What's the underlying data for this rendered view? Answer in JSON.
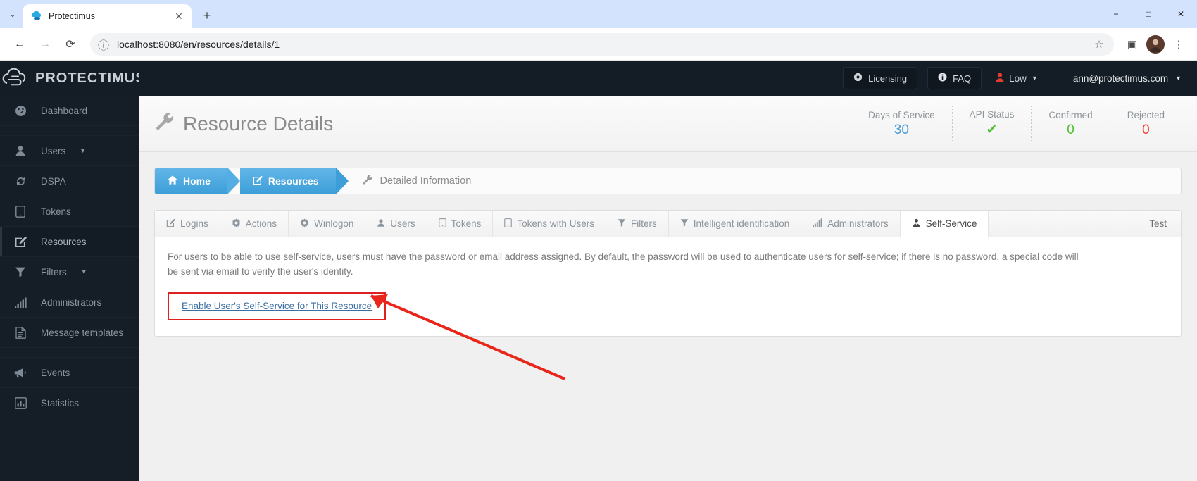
{
  "browser": {
    "tab_title": "Protectimus",
    "tab_close_glyph": "✕",
    "new_tab_glyph": "+",
    "tab_list_glyph": "⌄",
    "back_glyph": "←",
    "forward_glyph": "→",
    "reload_glyph": "⟳",
    "info_glyph": "ⓘ",
    "url": "localhost:8080/en/resources/details/1",
    "star_glyph": "☆",
    "sidepanel_glyph": "▣",
    "avatar_initial": "",
    "menu_glyph": "⋮",
    "minimize_glyph": "−",
    "maximize_glyph": "□",
    "close_glyph": "✕"
  },
  "brand": {
    "name": "PROTECTIMUS",
    "logo_icon": "cloud-lock-icon"
  },
  "sidebar": {
    "items": [
      {
        "label": "Dashboard",
        "icon": "dashboard-gauge-icon",
        "caret": false,
        "active": false
      },
      {
        "label": "Users",
        "icon": "user-icon",
        "caret": true,
        "active": false
      },
      {
        "label": "DSPA",
        "icon": "sync-icon",
        "caret": false,
        "active": false
      },
      {
        "label": "Tokens",
        "icon": "tablet-icon",
        "caret": false,
        "active": false
      },
      {
        "label": "Resources",
        "icon": "edit-square-icon",
        "caret": false,
        "active": true
      },
      {
        "label": "Filters",
        "icon": "funnel-icon",
        "caret": true,
        "active": false
      },
      {
        "label": "Administrators",
        "icon": "bar-chart-icon",
        "caret": false,
        "active": false
      },
      {
        "label": "Message templates",
        "icon": "document-icon",
        "caret": false,
        "active": false
      },
      {
        "label": "Events",
        "icon": "megaphone-icon",
        "caret": false,
        "active": false
      },
      {
        "label": "Statistics",
        "icon": "statistics-chart-icon",
        "caret": false,
        "active": false
      }
    ],
    "caret_glyph": "▼"
  },
  "topbar": {
    "licensing_label": "Licensing",
    "licensing_icon": "gear-badge-icon",
    "faq_label": "FAQ",
    "faq_icon": "info-circle-icon",
    "risk_label": "Low",
    "risk_icon": "user-risk-icon",
    "risk_color": "#e23c2f",
    "user_email": "ann@protectimus.com",
    "caret_glyph": "▼"
  },
  "header": {
    "title": "Resource Details",
    "title_icon": "wrench-icon",
    "stats": [
      {
        "label": "Days of Service",
        "value": "30",
        "color_class": "v-blue"
      },
      {
        "label": "API Status",
        "value": "✔",
        "color_class": "v-green"
      },
      {
        "label": "Confirmed",
        "value": "0",
        "color_class": "v-green"
      },
      {
        "label": "Rejected",
        "value": "0",
        "color_class": "v-red"
      }
    ]
  },
  "breadcrumb": {
    "home_label": "Home",
    "home_icon": "home-icon",
    "resources_label": "Resources",
    "resources_icon": "edit-square-icon",
    "current_label": "Detailed Information",
    "current_icon": "wrench-icon"
  },
  "tabs": {
    "items": [
      {
        "label": "Logins",
        "icon": "edit-square-icon",
        "active": false
      },
      {
        "label": "Actions",
        "icon": "gear-icon",
        "active": false
      },
      {
        "label": "Winlogon",
        "icon": "gear-icon",
        "active": false
      },
      {
        "label": "Users",
        "icon": "user-icon",
        "active": false
      },
      {
        "label": "Tokens",
        "icon": "tablet-icon",
        "active": false
      },
      {
        "label": "Tokens with Users",
        "icon": "tablet-icon",
        "active": false
      },
      {
        "label": "Filters",
        "icon": "funnel-icon",
        "active": false
      },
      {
        "label": "Intelligent identification",
        "icon": "funnel-icon",
        "active": false
      },
      {
        "label": "Administrators",
        "icon": "bar-chart-icon",
        "active": false
      },
      {
        "label": "Self-Service",
        "icon": "user-tie-icon",
        "active": true
      }
    ],
    "right_label": "Test"
  },
  "self_service": {
    "description": "For users to be able to use self-service, users must have the password or email address assigned. By default, the password will be used to authenticate users for self-service; if there is no password, a special code will be sent via email to verify the user's identity.",
    "enable_link_label": "Enable User's Self-Service for This Resource",
    "highlight_color": "#e02020"
  },
  "annotation": {
    "arrow_color": "#e8261c"
  }
}
